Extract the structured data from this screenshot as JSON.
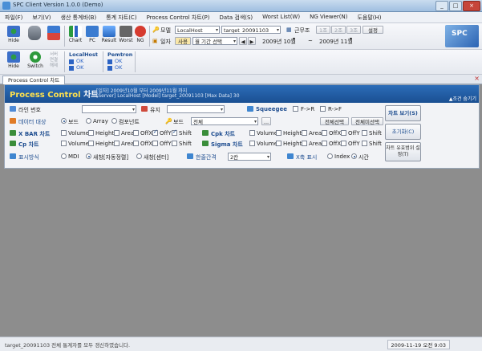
{
  "window": {
    "title": "SPC Client Version 1.0.0 (Demo)",
    "buttons": [
      "_",
      "□",
      "×"
    ]
  },
  "menu": [
    "파일(F)",
    "보기(V)",
    "생산 통계바(B)",
    "통계 자트(C)",
    "Process Control 차트(P)",
    "Data 검색(S)",
    "Worst List(W)",
    "NG Viewer(N)",
    "도움말(H)"
  ],
  "toolbar1": {
    "buttons": [
      "Hide",
      "Chart",
      "PC",
      "Result",
      "Worst",
      "NG"
    ],
    "model_label": "모델",
    "model_server": "LocalHost",
    "model_value": "target_20091103",
    "period_label": "근무조",
    "period_btns": [
      "1조",
      "2조",
      "3조",
      "설정"
    ],
    "date_label": "일자",
    "date_use": "사용",
    "date_range": "월 기간 선택",
    "date_from": "2009년 10월",
    "tilde": "~",
    "date_to": "2009년 11월"
  },
  "toolbar2": {
    "hide": "Hide",
    "switch": "Switch",
    "server_cap": [
      "서버",
      "연결",
      "해제"
    ],
    "servers": [
      {
        "name": "LocalHost",
        "st1": "OK",
        "st2": "OK"
      },
      {
        "name": "Pemtron",
        "st1": "OK",
        "st2": "OK"
      }
    ]
  },
  "tab": {
    "label": "Process Control 차트",
    "close": "×"
  },
  "panel": {
    "title_en": "Process Control",
    "title_ko": "차트",
    "info1": "[일자] 2009년10월 부터 2009년11월 까지",
    "info2": "[Server] LocalHost   [Model] target_20091103   [Max Data] 30",
    "hide_conditions": "▲조건 숨기기",
    "line_label": "라인 번호",
    "jig_label": "유지",
    "squeegee": "Squeegee",
    "f_r": "F->R",
    "r_f": "R->F",
    "data_target": "데이터 대상",
    "target_opts": [
      "보드",
      "Array",
      "컴포넌트"
    ],
    "board_label": "보드",
    "board_value": "전체",
    "dots": "...",
    "select_all": "전체선택",
    "deselect_all": "전체미선택",
    "xbar_label": "X BAR 차트",
    "cp_label": "Cp 차트",
    "cpk_label": "Cpk 차트",
    "sigma_label": "Sigma 차트",
    "opts": [
      "Volume",
      "Height",
      "Area",
      "OffX",
      "OffY",
      "Shift"
    ],
    "display_label": "표시방식",
    "display_opts": [
      "MDI",
      "새창[자동정렬]",
      "새창[센터]"
    ],
    "interval_label": "한줄간격",
    "interval_value": "2칸",
    "xaxis_label": "X축 표시",
    "xaxis_opts": [
      "Index",
      "시간"
    ],
    "btn_view": "차트 보기(S)",
    "btn_reset": "초기화(C)",
    "btn_valid": "차트 유효범위 설정(T)"
  },
  "status": {
    "text": "target_20091103 전체 통계자를 모두 갱신하였습니다.",
    "time": "2009-11-19 오전 9:03"
  },
  "colors": {
    "header": "#1a4f92",
    "accent": "#ffe14d",
    "workspace": "#8d8d8d"
  }
}
